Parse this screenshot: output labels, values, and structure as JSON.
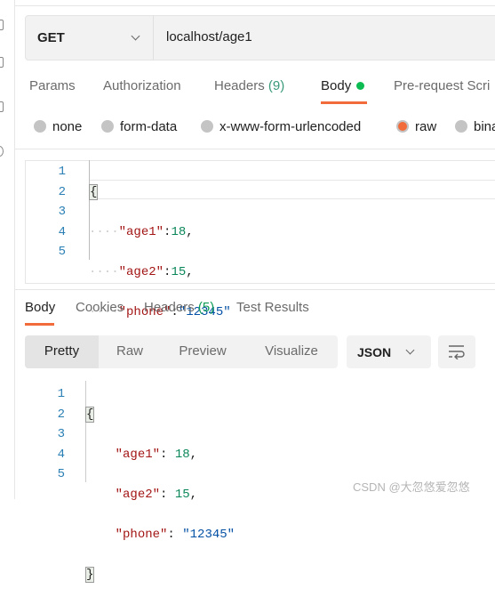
{
  "request": {
    "method": "GET",
    "url": "localhost/age1"
  },
  "request_tabs": [
    {
      "label": "Params"
    },
    {
      "label": "Authorization"
    },
    {
      "label": "Headers",
      "count": "(9)"
    },
    {
      "label": "Body"
    },
    {
      "label": "Pre-request Scri"
    }
  ],
  "body_types": [
    {
      "label": "none",
      "selected": false
    },
    {
      "label": "form-data",
      "selected": false
    },
    {
      "label": "x-www-form-urlencoded",
      "selected": false
    },
    {
      "label": "raw",
      "selected": true
    },
    {
      "label": "bina",
      "selected": false
    }
  ],
  "request_body": {
    "line_numbers": [
      "1",
      "2",
      "3",
      "4",
      "5"
    ],
    "open": "{",
    "close": "}",
    "indent": "····",
    "k1": "\"age1\"",
    "v1": "18",
    "k2": "\"age2\"",
    "v2": "15",
    "k3": "\"phone\"",
    "v3": "\"12345\""
  },
  "response_tabs": [
    {
      "label": "Body"
    },
    {
      "label": "Cookies"
    },
    {
      "label": "Headers",
      "count": "(5)"
    },
    {
      "label": "Test Results"
    }
  ],
  "view_modes": [
    "Pretty",
    "Raw",
    "Preview",
    "Visualize"
  ],
  "format": "JSON",
  "response_body": {
    "line_numbers": [
      "1",
      "2",
      "3",
      "4",
      "5"
    ],
    "open": "{",
    "close": "}",
    "k1": "\"age1\"",
    "v1": "18",
    "k2": "\"age2\"",
    "v2": "15",
    "k3": "\"phone\"",
    "v3": "\"12345\""
  },
  "watermark": "CSDN @大忽悠爱忽悠",
  "colors": {
    "accent": "#f26b3a",
    "count_green": "#0f9d58",
    "dot_green": "#0cbb52"
  }
}
